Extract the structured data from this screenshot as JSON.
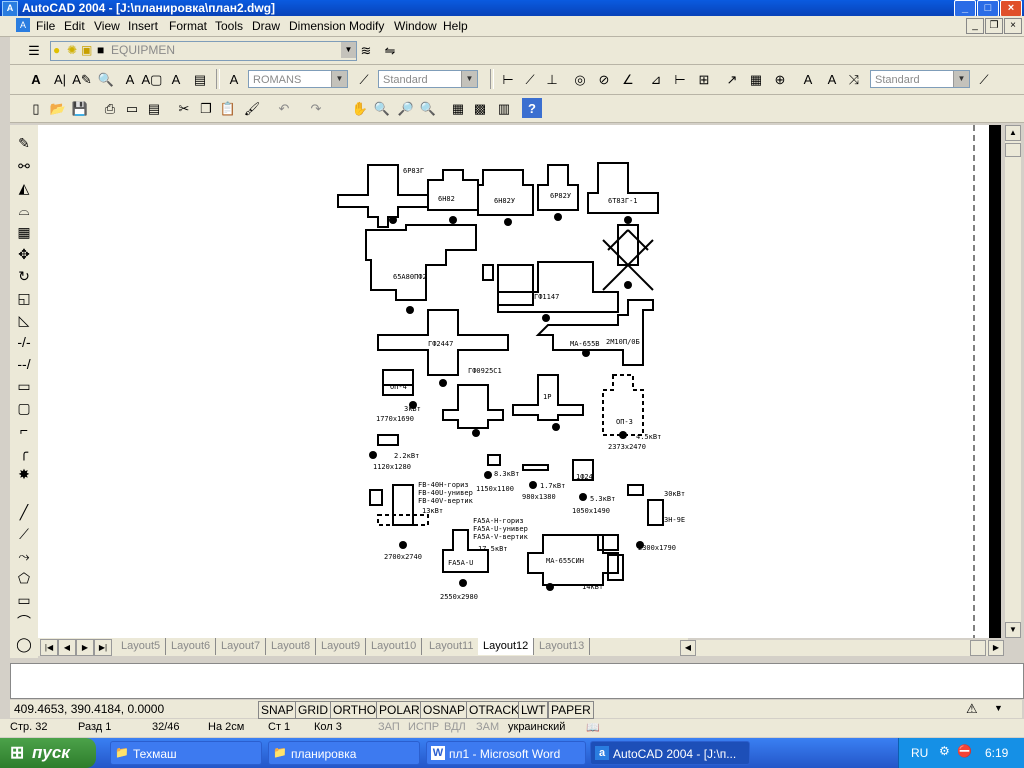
{
  "window": {
    "title": "AutoCAD 2004 - [J:\\планировка\\план2.dwg]"
  },
  "menu": [
    "File",
    "Edit",
    "View",
    "Insert",
    "Format",
    "Tools",
    "Draw",
    "Dimension",
    "Modify",
    "Window",
    "Help"
  ],
  "layer_toolbar": {
    "layer_value": "EQUIPMEN"
  },
  "styles_toolbar": {
    "text_style": "ROMANS",
    "dim_style": "Standard",
    "plot_style": "Standard"
  },
  "drawing": {
    "labels": [
      "6Р83Г",
      "6Н82",
      "6Н82У",
      "6Р82У",
      "6Т83Г-1",
      "65А80ПФ2",
      "ГФ1147",
      "ГФ2447",
      "МА-655В",
      "2М10П/0Б",
      "ГФ0925С1",
      "ОП-4",
      "1Р",
      "3кВт",
      "1770х1690",
      "ОП-3",
      "4.5кВт",
      "2373х2470",
      "2.2кВт",
      "1120х1280",
      "8.3кВт",
      "1.7кВт",
      "1150х1100",
      "980х1380",
      "1Ф24",
      "5.3кВт",
      "1050х1490",
      "FB-40Н-гориз",
      "FB-40U-универ",
      "FB-40V-вертик",
      "13кВт",
      "2700х2740",
      "FA5A-Н-гориз",
      "FA5A-U-универ",
      "FA5A-V-вертик",
      "17.5кВт",
      "FA5A-U",
      "2550х2980",
      "МА-655СИН",
      "14кВт",
      "30кВт",
      "3Н-9Е",
      "2300х1790"
    ]
  },
  "tabs": [
    "Layout5",
    "Layout6",
    "Layout7",
    "Layout8",
    "Layout9",
    "Layout10",
    "Layout11",
    "Layout12",
    "Layout13"
  ],
  "active_tab": "Layout12",
  "coordinates": "409.4653, 390.4184, 0.0000",
  "status_buttons": [
    "SNAP",
    "GRID",
    "ORTHO",
    "POLAR",
    "OSNAP",
    "OTRACK",
    "LWT",
    "PAPER"
  ],
  "word_status": {
    "page": "Стр. 32",
    "section": "Разд 1",
    "pages": "32/46",
    "at": "На 2см",
    "line": "Ст 1",
    "col": "Кол 3",
    "rec": "ЗАП",
    "trk": "ИСПР",
    "ext": "ВДЛ",
    "ovr": "ЗАМ",
    "lang": "украинский"
  },
  "taskbar": {
    "start": "пуск",
    "tasks": [
      "Техмаш",
      "планировка",
      "пл1 - Microsoft Word",
      "AutoCAD 2004 - [J:\\п..."
    ],
    "lang": "RU",
    "time": "6:19"
  }
}
